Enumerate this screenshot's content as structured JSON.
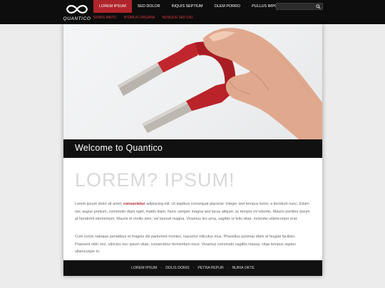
{
  "brand": {
    "name": "QUANTICO"
  },
  "nav": {
    "items": [
      {
        "label": "LOREM IPSUM",
        "active": true
      },
      {
        "label": "SED DOLOR",
        "active": false
      },
      {
        "label": "INQUIS SEPTIUM",
        "active": false
      },
      {
        "label": "OLEM PORRO",
        "active": false
      },
      {
        "label": "PULLUS IMPOUS",
        "active": false
      }
    ],
    "subitems": [
      "NUMIS MATIC",
      "IPSIMUS ORGANA",
      "NUNQUE SED DIU"
    ]
  },
  "search": {
    "placeholder": "",
    "icon": "search-icon"
  },
  "hero": {
    "image": "hand holding red horseshoe magnet"
  },
  "welcome": {
    "title": "Welcome to Quantico"
  },
  "content": {
    "headline": "LOREM? IPSUM!",
    "para1_before": "Lorem ipsum dolor sit amet, ",
    "para1_link": "consectetur",
    "para1_after": " adipiscing elit. Ut dapibus consequat placerat. Integer sed tempus tortor, a tincidunt nunc. Etiam nec augue pretium, commodo diam eget, mattis diam. Nunc semper magna sed lacus aliquet, ac tempor mi lobortis. Mauris porttitor ipsum at hendrerit elementum. Mauris et mollis sem, vel laoreet magna. Vivamus leo urna, sagittis ut felis vitae, molestie ullamcorper erat.",
    "para2": "Cum sociis natoque penatibus et magnis dis parturient montes, nascetur ridiculus mus. Phasellus pulvinar diam et feugiat facilisis. Praesent nibh orci, ultricies nec ipsum vitae, consectetur fermentum risus. Vivamus commodo sagittis massa, vitae tempus sapien ullamcorper in."
  },
  "footer": {
    "links": [
      "LOREM IPSUM",
      "DOLIS DORIS",
      "PETRA PEPUR",
      "NURIA OKTE"
    ],
    "separator": "-"
  },
  "colors": {
    "accent": "#b0252b",
    "header_bg": "#0d0d0d",
    "page_bg": "#ececec"
  }
}
